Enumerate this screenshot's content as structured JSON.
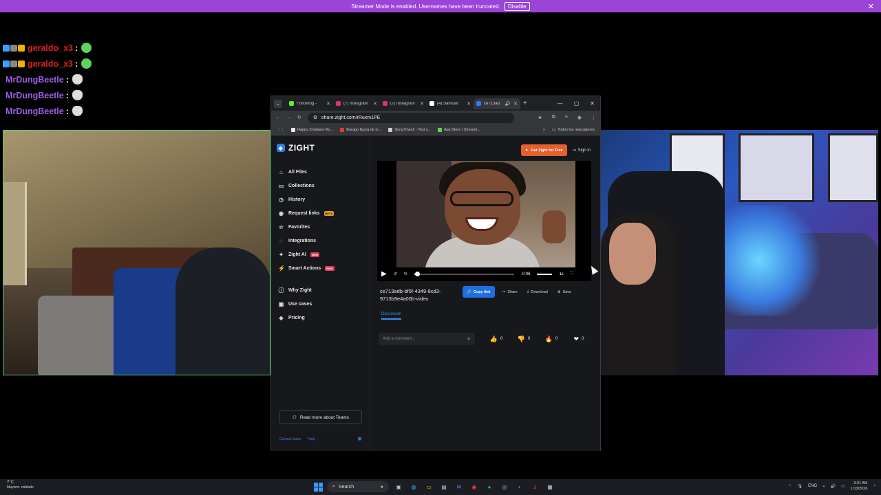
{
  "banner": {
    "message": "Streamer Mode is enabled. Usernames have been truncated.",
    "disable_label": "Disable",
    "close_glyph": "✕",
    "color": "#9b44d8"
  },
  "chat": [
    {
      "user": "geraldo_x3",
      "color": "#e02020",
      "badges": true,
      "emote": "green-emote"
    },
    {
      "user": "geraldo_x3",
      "color": "#e02020",
      "badges": true,
      "emote": "green-emote"
    },
    {
      "user": "MrDungBeetle",
      "color": "#9b5de5",
      "badges": false,
      "emote": "white-emote"
    },
    {
      "user": "MrDungBeetle",
      "color": "#9b5de5",
      "badges": false,
      "emote": "white-emote"
    },
    {
      "user": "MrDungBeetle",
      "color": "#9b5de5",
      "badges": false,
      "emote": "white-emote"
    }
  ],
  "chat_sep": ":",
  "browser": {
    "tabs": [
      {
        "title": "Following - ",
        "fav": "#53fc18",
        "active": false
      },
      {
        "title": "(7) Instagram",
        "fav": "#e1306c",
        "active": false
      },
      {
        "title": "(7) Instagram",
        "fav": "#e1306c",
        "active": false
      },
      {
        "title": "(4) Samoan ",
        "fav": "#ffffff",
        "icon": "x-icon",
        "active": false
      },
      {
        "title": "ce713ad",
        "fav": "#2a7cf7",
        "active": true
      }
    ],
    "url": "share.zight.com/rRuxm1PE",
    "bookmarks": [
      {
        "label": "Happy Cristiano Ro...",
        "fav": "#e8e8e8"
      },
      {
        "label": "Burago figura de lo...",
        "fav": "#e03a3a"
      },
      {
        "label": "SongTrivia2 - Test y...",
        "fav": "#cccccc"
      },
      {
        "label": "App Store / Streaml...",
        "fav": "#5fd35f"
      }
    ],
    "bookmarks_more": "»",
    "all_bookmarks": "Todos los marcadores"
  },
  "zight": {
    "logo": "ZIGHT",
    "nav": [
      {
        "label": "All Files",
        "icon": "home-icon",
        "glyph": "⌂"
      },
      {
        "label": "Collections",
        "icon": "folder-icon",
        "glyph": "▭"
      },
      {
        "label": "History",
        "icon": "clock-icon",
        "glyph": "◷"
      },
      {
        "label": "Request links",
        "icon": "link-request-icon",
        "glyph": "◉",
        "tag": "BETA"
      },
      {
        "label": "Favorites",
        "icon": "star-icon",
        "glyph": "☆"
      },
      {
        "label": "Integrations",
        "icon": "plug-icon",
        "glyph": "◌"
      },
      {
        "label": "Zight AI",
        "icon": "sparkle-icon",
        "glyph": "✦",
        "tag": "NEW",
        "tag_style": "new"
      },
      {
        "label": "Smart Actions",
        "icon": "bolt-icon",
        "glyph": "⚡",
        "tag": "NEW",
        "tag_style": "new"
      }
    ],
    "nav2": [
      {
        "label": "Why Zight",
        "icon": "info-icon",
        "glyph": "ⓘ"
      },
      {
        "label": "Use cases",
        "icon": "briefcase-icon",
        "glyph": "▣"
      },
      {
        "label": "Pricing",
        "icon": "tag-icon",
        "glyph": "◈"
      }
    ],
    "teams_label": "Read more about Teams",
    "contact_sales": "Contact Sales",
    "help": "Help",
    "get_label": "Get Zight for Free",
    "signin": "Sign in",
    "player": {
      "time": "-0:06",
      "speed": "1x",
      "progress": 0.03
    },
    "file_title": "ce713adb-bf5f-4349-8cd3-9713b9e4a00b-video",
    "actions": {
      "copy": "Copy link",
      "share": "Share",
      "download": "Download",
      "save": "Save"
    },
    "discussion": "Discussion",
    "comment_placeholder": "Add a comment...",
    "reactions": [
      {
        "emoji": "👍",
        "count": "0",
        "icon": "thumbs-up-icon"
      },
      {
        "emoji": "👎",
        "count": "0",
        "icon": "thumbs-down-icon"
      },
      {
        "emoji": "🔥",
        "count": "0",
        "icon": "fire-icon"
      },
      {
        "emoji": "❤",
        "count": "0",
        "icon": "heart-icon"
      }
    ],
    "accent": "#1f6fe0",
    "orange": "#e5602a"
  },
  "taskbar": {
    "temp": "7°C",
    "weather": "Mayorm. nublado",
    "search": "Search",
    "lang": "ENG",
    "time": "3:31 AM",
    "date": "1/13/2026"
  }
}
